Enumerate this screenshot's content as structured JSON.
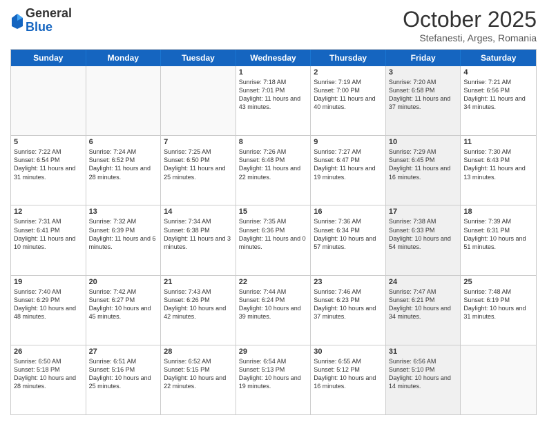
{
  "header": {
    "logo_general": "General",
    "logo_blue": "Blue",
    "month_title": "October 2025",
    "subtitle": "Stefanesti, Arges, Romania"
  },
  "weekdays": [
    "Sunday",
    "Monday",
    "Tuesday",
    "Wednesday",
    "Thursday",
    "Friday",
    "Saturday"
  ],
  "rows": [
    [
      {
        "day": "",
        "text": "",
        "empty": true
      },
      {
        "day": "",
        "text": "",
        "empty": true
      },
      {
        "day": "",
        "text": "",
        "empty": true
      },
      {
        "day": "1",
        "text": "Sunrise: 7:18 AM\nSunset: 7:01 PM\nDaylight: 11 hours and 43 minutes.",
        "shaded": false
      },
      {
        "day": "2",
        "text": "Sunrise: 7:19 AM\nSunset: 7:00 PM\nDaylight: 11 hours and 40 minutes.",
        "shaded": false
      },
      {
        "day": "3",
        "text": "Sunrise: 7:20 AM\nSunset: 6:58 PM\nDaylight: 11 hours and 37 minutes.",
        "shaded": true
      },
      {
        "day": "4",
        "text": "Sunrise: 7:21 AM\nSunset: 6:56 PM\nDaylight: 11 hours and 34 minutes.",
        "shaded": false
      }
    ],
    [
      {
        "day": "5",
        "text": "Sunrise: 7:22 AM\nSunset: 6:54 PM\nDaylight: 11 hours and 31 minutes.",
        "shaded": false
      },
      {
        "day": "6",
        "text": "Sunrise: 7:24 AM\nSunset: 6:52 PM\nDaylight: 11 hours and 28 minutes.",
        "shaded": false
      },
      {
        "day": "7",
        "text": "Sunrise: 7:25 AM\nSunset: 6:50 PM\nDaylight: 11 hours and 25 minutes.",
        "shaded": false
      },
      {
        "day": "8",
        "text": "Sunrise: 7:26 AM\nSunset: 6:48 PM\nDaylight: 11 hours and 22 minutes.",
        "shaded": false
      },
      {
        "day": "9",
        "text": "Sunrise: 7:27 AM\nSunset: 6:47 PM\nDaylight: 11 hours and 19 minutes.",
        "shaded": false
      },
      {
        "day": "10",
        "text": "Sunrise: 7:29 AM\nSunset: 6:45 PM\nDaylight: 11 hours and 16 minutes.",
        "shaded": true
      },
      {
        "day": "11",
        "text": "Sunrise: 7:30 AM\nSunset: 6:43 PM\nDaylight: 11 hours and 13 minutes.",
        "shaded": false
      }
    ],
    [
      {
        "day": "12",
        "text": "Sunrise: 7:31 AM\nSunset: 6:41 PM\nDaylight: 11 hours and 10 minutes.",
        "shaded": false
      },
      {
        "day": "13",
        "text": "Sunrise: 7:32 AM\nSunset: 6:39 PM\nDaylight: 11 hours and 6 minutes.",
        "shaded": false
      },
      {
        "day": "14",
        "text": "Sunrise: 7:34 AM\nSunset: 6:38 PM\nDaylight: 11 hours and 3 minutes.",
        "shaded": false
      },
      {
        "day": "15",
        "text": "Sunrise: 7:35 AM\nSunset: 6:36 PM\nDaylight: 11 hours and 0 minutes.",
        "shaded": false
      },
      {
        "day": "16",
        "text": "Sunrise: 7:36 AM\nSunset: 6:34 PM\nDaylight: 10 hours and 57 minutes.",
        "shaded": false
      },
      {
        "day": "17",
        "text": "Sunrise: 7:38 AM\nSunset: 6:33 PM\nDaylight: 10 hours and 54 minutes.",
        "shaded": true
      },
      {
        "day": "18",
        "text": "Sunrise: 7:39 AM\nSunset: 6:31 PM\nDaylight: 10 hours and 51 minutes.",
        "shaded": false
      }
    ],
    [
      {
        "day": "19",
        "text": "Sunrise: 7:40 AM\nSunset: 6:29 PM\nDaylight: 10 hours and 48 minutes.",
        "shaded": false
      },
      {
        "day": "20",
        "text": "Sunrise: 7:42 AM\nSunset: 6:27 PM\nDaylight: 10 hours and 45 minutes.",
        "shaded": false
      },
      {
        "day": "21",
        "text": "Sunrise: 7:43 AM\nSunset: 6:26 PM\nDaylight: 10 hours and 42 minutes.",
        "shaded": false
      },
      {
        "day": "22",
        "text": "Sunrise: 7:44 AM\nSunset: 6:24 PM\nDaylight: 10 hours and 39 minutes.",
        "shaded": false
      },
      {
        "day": "23",
        "text": "Sunrise: 7:46 AM\nSunset: 6:23 PM\nDaylight: 10 hours and 37 minutes.",
        "shaded": false
      },
      {
        "day": "24",
        "text": "Sunrise: 7:47 AM\nSunset: 6:21 PM\nDaylight: 10 hours and 34 minutes.",
        "shaded": true
      },
      {
        "day": "25",
        "text": "Sunrise: 7:48 AM\nSunset: 6:19 PM\nDaylight: 10 hours and 31 minutes.",
        "shaded": false
      }
    ],
    [
      {
        "day": "26",
        "text": "Sunrise: 6:50 AM\nSunset: 5:18 PM\nDaylight: 10 hours and 28 minutes.",
        "shaded": false
      },
      {
        "day": "27",
        "text": "Sunrise: 6:51 AM\nSunset: 5:16 PM\nDaylight: 10 hours and 25 minutes.",
        "shaded": false
      },
      {
        "day": "28",
        "text": "Sunrise: 6:52 AM\nSunset: 5:15 PM\nDaylight: 10 hours and 22 minutes.",
        "shaded": false
      },
      {
        "day": "29",
        "text": "Sunrise: 6:54 AM\nSunset: 5:13 PM\nDaylight: 10 hours and 19 minutes.",
        "shaded": false
      },
      {
        "day": "30",
        "text": "Sunrise: 6:55 AM\nSunset: 5:12 PM\nDaylight: 10 hours and 16 minutes.",
        "shaded": false
      },
      {
        "day": "31",
        "text": "Sunrise: 6:56 AM\nSunset: 5:10 PM\nDaylight: 10 hours and 14 minutes.",
        "shaded": true
      },
      {
        "day": "",
        "text": "",
        "empty": true
      }
    ]
  ]
}
